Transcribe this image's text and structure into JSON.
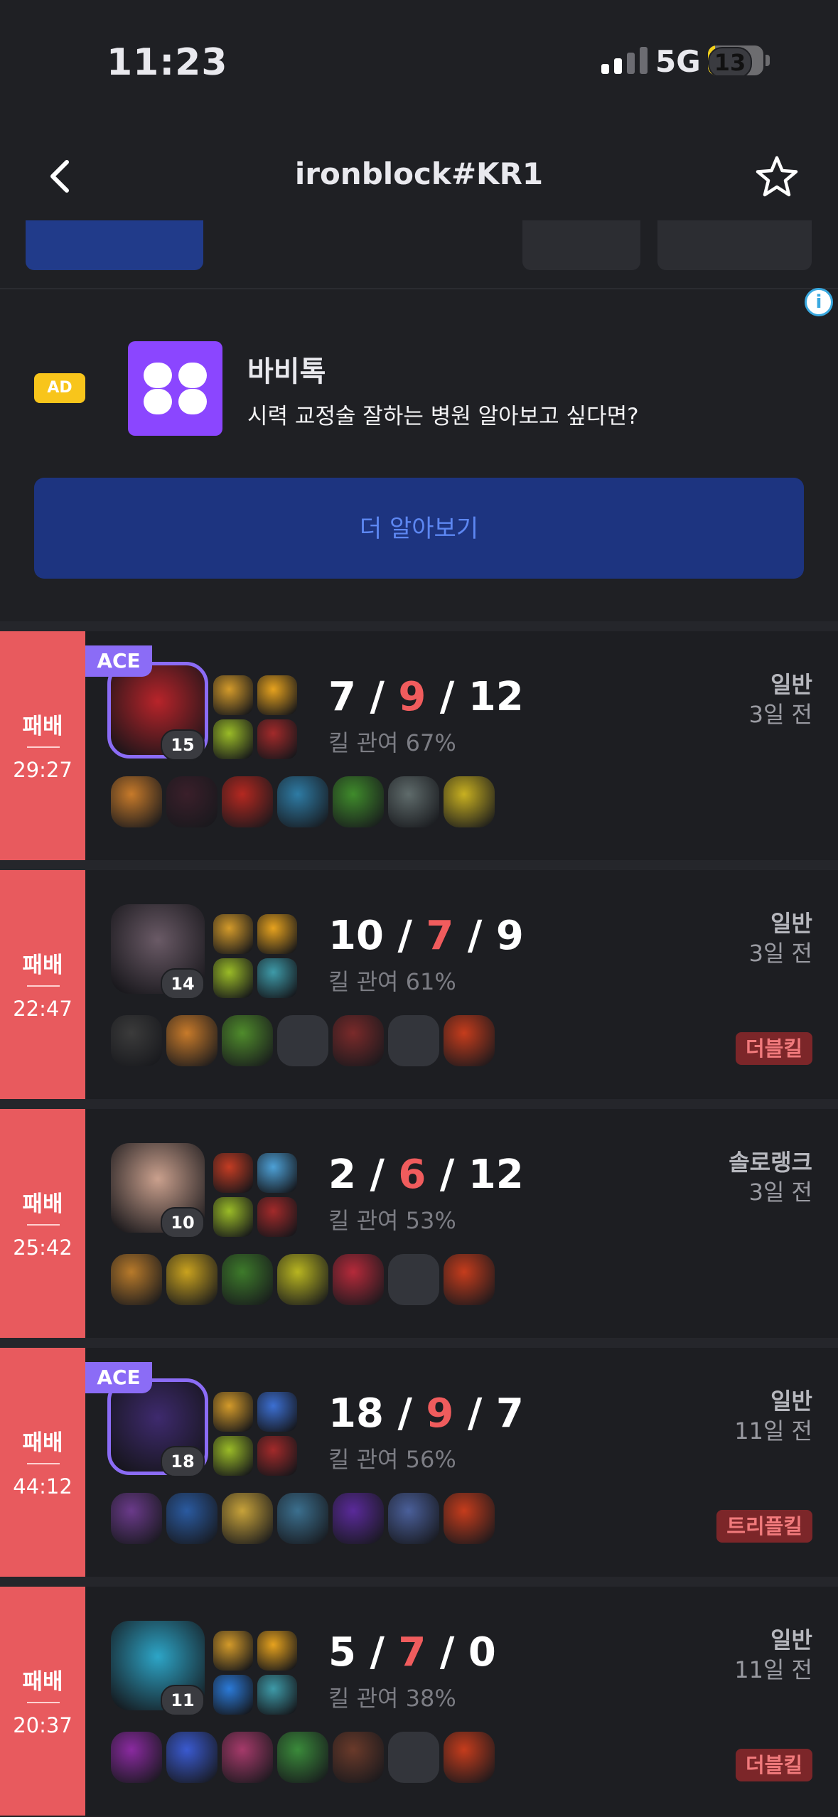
{
  "status": {
    "time": "11:23",
    "network": "5G",
    "battery": "13",
    "battery_level": 0.13
  },
  "nav": {
    "title": "ironblock#KR1"
  },
  "ad": {
    "badge": "AD",
    "info_symbol": "i",
    "title": "바비톡",
    "description": "시력 교정술 잘하는 병원 알아보고 싶다면?",
    "cta": "더 알아보기",
    "colors": {
      "logo": "#8b46ff",
      "cta_bg": "#1d3480",
      "badge": "#f8c51b"
    }
  },
  "matches": [
    {
      "result": "패배",
      "duration": "29:27",
      "ace": "ACE",
      "level": "15",
      "kills": "7",
      "deaths": "9",
      "assists": "12",
      "sep": "/",
      "kill_participation": "킬 관여 67%",
      "game_type": "일반",
      "ago": "3일 전",
      "multikill": "",
      "champ_color": "#b8242a",
      "spells": [
        "#d39a2a",
        "#e6a21e",
        "#9abb27",
        "#a22a2a"
      ],
      "items": [
        "#c77a2a",
        "#3a1f2a",
        "#b42820",
        "#2e7ba4",
        "#3f8b2b",
        "#5f6b6b",
        "#c8b020"
      ]
    },
    {
      "result": "패배",
      "duration": "22:47",
      "ace": "",
      "level": "14",
      "kills": "10",
      "deaths": "7",
      "assists": "9",
      "sep": "/",
      "kill_participation": "킬 관여 61%",
      "game_type": "일반",
      "ago": "3일 전",
      "multikill": "더블킬",
      "champ_color": "#6a5a66",
      "spells": [
        "#d39a2a",
        "#e6a21e",
        "#9abb27",
        "#3e9aa8"
      ],
      "items": [
        "#3b3b3b",
        "#c77a2a",
        "#4f8b2b",
        "",
        "#7a2a2a",
        "",
        "#c53c1c"
      ]
    },
    {
      "result": "패배",
      "duration": "25:42",
      "ace": "",
      "level": "10",
      "kills": "2",
      "deaths": "6",
      "assists": "12",
      "sep": "/",
      "kill_participation": "킬 관여 53%",
      "game_type": "솔로랭크",
      "ago": "3일 전",
      "multikill": "",
      "champ_color": "#caa08d",
      "spells": [
        "#c33c23",
        "#4da0d6",
        "#9abb27",
        "#a22a2a"
      ],
      "items": [
        "#b87a2a",
        "#c9a21e",
        "#3d7a2a",
        "#b8b520",
        "#b52a3a",
        "",
        "#c53c1c"
      ]
    },
    {
      "result": "패배",
      "duration": "44:12",
      "ace": "ACE",
      "level": "18",
      "kills": "18",
      "deaths": "9",
      "assists": "7",
      "sep": "/",
      "kill_participation": "킬 관여 56%",
      "game_type": "일반",
      "ago": "11일 전",
      "multikill": "트리플킬",
      "champ_color": "#3e2a6e",
      "spells": [
        "#d39a2a",
        "#3c6fd2",
        "#9abb27",
        "#a22a2a"
      ],
      "items": [
        "#6a3a8a",
        "#2a5aa0",
        "#c7a23a",
        "#3b6f8e",
        "#5a2a9a",
        "#4a5f9a",
        "#c53c1c"
      ]
    },
    {
      "result": "패배",
      "duration": "20:37",
      "ace": "",
      "level": "11",
      "kills": "5",
      "deaths": "7",
      "assists": "0",
      "sep": "/",
      "kill_participation": "킬 관여 38%",
      "game_type": "일반",
      "ago": "11일 전",
      "multikill": "더블킬",
      "champ_color": "#2da5c7",
      "spells": [
        "#d39a2a",
        "#e6a21e",
        "#2b7ad8",
        "#3e9aa8"
      ],
      "items": [
        "#8a2aa0",
        "#3a5ad0",
        "#a53a6a",
        "#3a8a3a",
        "#6a3a2a",
        "",
        "#c53c1c"
      ]
    }
  ]
}
